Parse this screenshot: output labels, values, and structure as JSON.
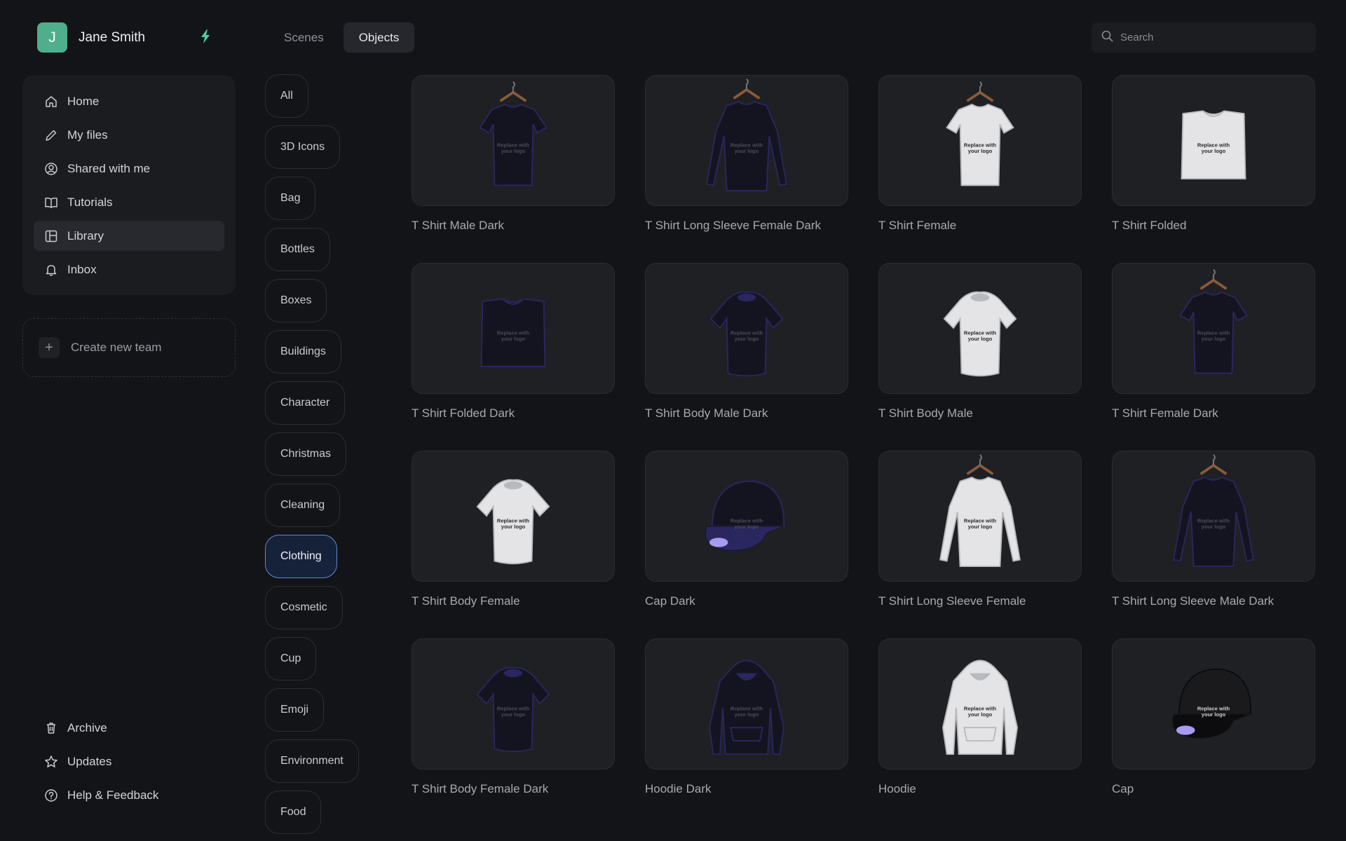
{
  "user": {
    "initial": "J",
    "name": "Jane Smith",
    "avatar_color": "#4fae8c"
  },
  "tabs": [
    {
      "label": "Scenes",
      "active": false
    },
    {
      "label": "Objects",
      "active": true
    }
  ],
  "search": {
    "placeholder": "Search",
    "value": ""
  },
  "sidebar": {
    "items": [
      {
        "label": "Home",
        "icon": "home-icon"
      },
      {
        "label": "My files",
        "icon": "pencil-icon"
      },
      {
        "label": "Shared with me",
        "icon": "user-circle-icon"
      },
      {
        "label": "Tutorials",
        "icon": "book-icon"
      },
      {
        "label": "Library",
        "icon": "library-icon",
        "active": true
      },
      {
        "label": "Inbox",
        "icon": "bell-icon"
      }
    ],
    "create_team": "Create new team",
    "bottom_items": [
      {
        "label": "Archive",
        "icon": "trash-icon"
      },
      {
        "label": "Updates",
        "icon": "star-icon"
      },
      {
        "label": "Help & Feedback",
        "icon": "help-icon"
      }
    ]
  },
  "categories": [
    {
      "label": "All"
    },
    {
      "label": "3D Icons"
    },
    {
      "label": "Bag"
    },
    {
      "label": "Bottles"
    },
    {
      "label": "Boxes"
    },
    {
      "label": "Buildings"
    },
    {
      "label": "Character"
    },
    {
      "label": "Christmas"
    },
    {
      "label": "Cleaning"
    },
    {
      "label": "Clothing",
      "active": true
    },
    {
      "label": "Cosmetic"
    },
    {
      "label": "Cup"
    },
    {
      "label": "Emoji"
    },
    {
      "label": "Environment"
    },
    {
      "label": "Food"
    }
  ],
  "objects": [
    {
      "name": "T Shirt Male Dark",
      "kind": "tshirt-hanger",
      "tone": "dark"
    },
    {
      "name": "T Shirt Long Sleeve Female Dark",
      "kind": "longsleeve-hanger",
      "tone": "dark"
    },
    {
      "name": "T Shirt Female",
      "kind": "tshirt-hanger",
      "tone": "light"
    },
    {
      "name": "T Shirt Folded",
      "kind": "folded",
      "tone": "light"
    },
    {
      "name": "T Shirt Folded Dark",
      "kind": "folded",
      "tone": "dark"
    },
    {
      "name": "T Shirt Body Male Dark",
      "kind": "tshirt-body",
      "tone": "dark"
    },
    {
      "name": "T Shirt Body Male",
      "kind": "tshirt-body",
      "tone": "light"
    },
    {
      "name": "T Shirt Female Dark",
      "kind": "tshirt-hanger",
      "tone": "dark"
    },
    {
      "name": "T Shirt Body Female",
      "kind": "tshirt-body",
      "tone": "light"
    },
    {
      "name": "Cap Dark",
      "kind": "cap",
      "tone": "dark"
    },
    {
      "name": "T Shirt Long Sleeve Female",
      "kind": "longsleeve-hanger",
      "tone": "light"
    },
    {
      "name": "T Shirt Long Sleeve Male Dark",
      "kind": "longsleeve-hanger",
      "tone": "dark"
    },
    {
      "name": "T Shirt Body Female Dark",
      "kind": "tshirt-body",
      "tone": "dark"
    },
    {
      "name": "Hoodie Dark",
      "kind": "hoodie",
      "tone": "dark"
    },
    {
      "name": "Hoodie",
      "kind": "hoodie",
      "tone": "light"
    },
    {
      "name": "Cap",
      "kind": "cap",
      "tone": "black"
    }
  ],
  "mockup_text": "Replace with your logo"
}
